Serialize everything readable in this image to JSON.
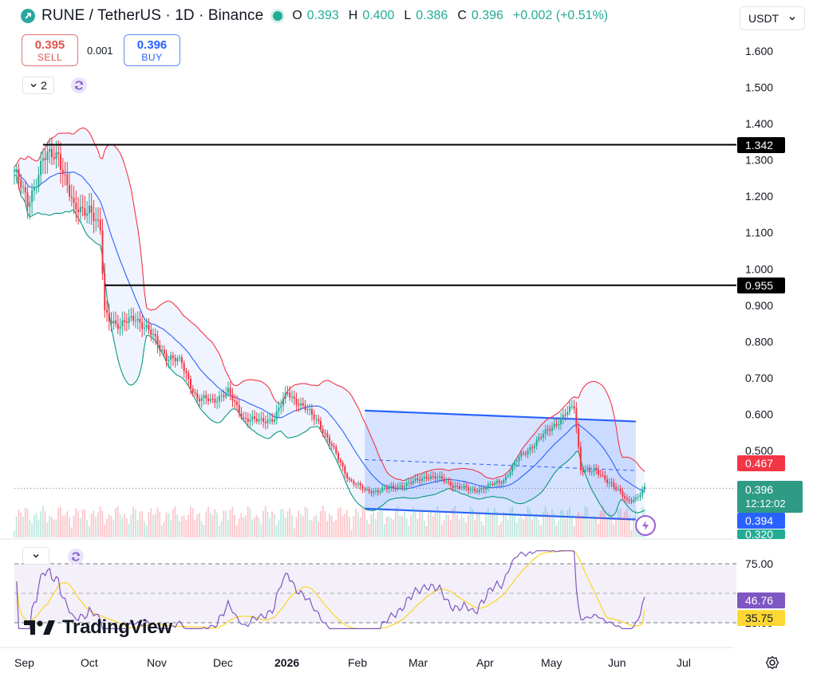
{
  "header": {
    "symbol": "RUNE / TetherUS · 1D · Binance",
    "ohlc": [
      {
        "k": "O",
        "v": "0.393"
      },
      {
        "k": "H",
        "v": "0.400"
      },
      {
        "k": "L",
        "v": "0.386"
      },
      {
        "k": "C",
        "v": "0.396"
      }
    ],
    "change": "+0.002 (+0.51%)",
    "market_status_color": "#22ab94"
  },
  "trade": {
    "sell_price": "0.395",
    "sell_label": "SELL",
    "buy_price": "0.396",
    "buy_label": "BUY",
    "spread": "0.001"
  },
  "currency": {
    "value": "USDT",
    "icon": "chevron-down-icon"
  },
  "indicators": {
    "main_count": "2",
    "main_icon": "chevron-down-icon",
    "rsi_icon": "chevron-down-icon",
    "cycle_icon": "cycle-icon"
  },
  "price_axis": {
    "ticks": [
      "1.600",
      "1.500",
      "1.400",
      "1.300",
      "1.200",
      "1.100",
      "1.000",
      "0.900",
      "0.800",
      "0.700",
      "0.600",
      "0.500"
    ],
    "tags": {
      "level_high": "1.342",
      "level_mid": "0.955",
      "band_upper": "0.467",
      "last_price": "0.396",
      "countdown": "12:12:02",
      "band_mid": "0.394",
      "band_lower": "0.320"
    }
  },
  "rsi_axis": {
    "ticks": [
      "75.00",
      "25.00"
    ],
    "rsi_value": "46.76",
    "rsi_ma_value": "35.75"
  },
  "time_axis": [
    "Sep",
    "Oct",
    "Nov",
    "Dec",
    "2026",
    "Feb",
    "Mar",
    "Apr",
    "May",
    "Jun",
    "Jul"
  ],
  "watermark": "TradingView",
  "colors": {
    "up": "#22ab94",
    "down": "#f23645",
    "bb_basis": "#2962ff",
    "bb_upper": "#f23645",
    "bb_lower": "#089981",
    "rsi_line": "#7e57c2",
    "rsi_ma": "#fdd835",
    "channel": "#2962ff"
  },
  "chart_data": {
    "type": "candlestick",
    "symbol": "RUNE/USDT",
    "interval": "1D",
    "price_range": [
      0.3,
      1.6
    ],
    "horizontal_levels": [
      1.342,
      0.955
    ],
    "channel": {
      "upper_start": 0.61,
      "upper_end": 0.58,
      "lower_start": 0.34,
      "lower_end": 0.31,
      "mid_start": 0.475,
      "mid_end": 0.445
    },
    "bollinger_bands": {
      "upper": 0.467,
      "basis": 0.394,
      "lower": 0.32
    },
    "close_anchors": [
      {
        "date": "Aug 30",
        "v": 1.27
      },
      {
        "date": "Sep 5",
        "v": 1.18
      },
      {
        "date": "Sep 12",
        "v": 1.3
      },
      {
        "date": "Sep 19",
        "v": 1.32
      },
      {
        "date": "Sep 26",
        "v": 1.16
      },
      {
        "date": "Oct 3",
        "v": 1.17
      },
      {
        "date": "Oct 8",
        "v": 1.1
      },
      {
        "date": "Oct 10",
        "v": 0.88
      },
      {
        "date": "Oct 17",
        "v": 0.84
      },
      {
        "date": "Oct 24",
        "v": 0.87
      },
      {
        "date": "Oct 31",
        "v": 0.82
      },
      {
        "date": "Nov 7",
        "v": 0.76
      },
      {
        "date": "Nov 14",
        "v": 0.74
      },
      {
        "date": "Nov 21",
        "v": 0.64
      },
      {
        "date": "Nov 28",
        "v": 0.64
      },
      {
        "date": "Dec 5",
        "v": 0.66
      },
      {
        "date": "Dec 12",
        "v": 0.59
      },
      {
        "date": "Dec 19",
        "v": 0.58
      },
      {
        "date": "Dec 26",
        "v": 0.59
      },
      {
        "date": "Jan 1",
        "v": 0.66
      },
      {
        "date": "Jan 8",
        "v": 0.62
      },
      {
        "date": "Jan 15",
        "v": 0.58
      },
      {
        "date": "Jan 22",
        "v": 0.5
      },
      {
        "date": "Jan 29",
        "v": 0.42
      },
      {
        "date": "Feb 5",
        "v": 0.39
      },
      {
        "date": "Feb 12",
        "v": 0.39
      },
      {
        "date": "Feb 19",
        "v": 0.4
      },
      {
        "date": "Feb 26",
        "v": 0.41
      },
      {
        "date": "Mar 5",
        "v": 0.43
      },
      {
        "date": "Mar 12",
        "v": 0.42
      },
      {
        "date": "Mar 19",
        "v": 0.4
      },
      {
        "date": "Mar 26",
        "v": 0.39
      },
      {
        "date": "Apr 2",
        "v": 0.4
      },
      {
        "date": "Apr 9",
        "v": 0.42
      },
      {
        "date": "Apr 16",
        "v": 0.48
      },
      {
        "date": "Apr 23",
        "v": 0.52
      },
      {
        "date": "Apr 30",
        "v": 0.56
      },
      {
        "date": "May 7",
        "v": 0.6
      },
      {
        "date": "May 11",
        "v": 0.62
      },
      {
        "date": "May 14",
        "v": 0.45
      },
      {
        "date": "May 21",
        "v": 0.44
      },
      {
        "date": "May 28",
        "v": 0.41
      },
      {
        "date": "Jun 4",
        "v": 0.36
      },
      {
        "date": "Jun 8",
        "v": 0.37
      },
      {
        "date": "Jun 12",
        "v": 0.396
      }
    ],
    "rsi": {
      "range": [
        25,
        75
      ],
      "last": 46.76,
      "ma_last": 35.75
    }
  }
}
